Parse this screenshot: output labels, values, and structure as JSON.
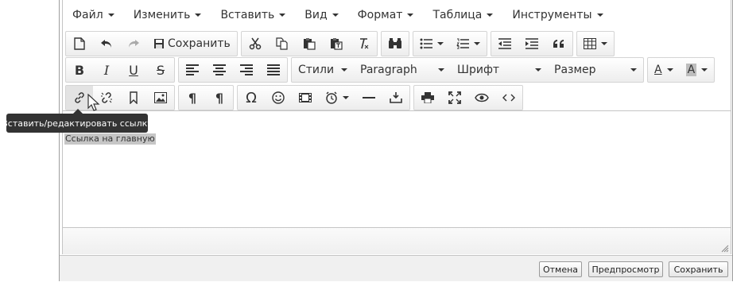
{
  "menubar": {
    "items": [
      {
        "label": "Файл"
      },
      {
        "label": "Изменить"
      },
      {
        "label": "Вставить"
      },
      {
        "label": "Вид"
      },
      {
        "label": "Формат"
      },
      {
        "label": "Таблица"
      },
      {
        "label": "Инструменты"
      }
    ]
  },
  "toolbar1": {
    "new_icon": "new-document-icon",
    "undo_icon": "undo-icon",
    "redo_icon": "redo-icon",
    "save_label": "Сохранить",
    "cut_icon": "cut-icon",
    "copy_icon": "copy-icon",
    "paste_icon": "paste-icon",
    "paste_text_icon": "paste-text-icon",
    "clear_format_icon": "clear-format-icon",
    "find_icon": "find-replace-icon",
    "bullist_icon": "bullet-list-icon",
    "numlist_icon": "numbered-list-icon",
    "outdent_icon": "outdent-icon",
    "indent_icon": "indent-icon",
    "quote_icon": "blockquote-icon",
    "table_icon": "table-icon"
  },
  "toolbar2": {
    "styles_label": "Стили",
    "format_label": "Paragraph",
    "font_label": "Шрифт",
    "size_label": "Размер",
    "text_color_label": "A",
    "bg_color_label": "A"
  },
  "toolbar3": {
    "tooltip": "Вставить/редактировать ссылку"
  },
  "content": {
    "link_text": "Ссылка на главную"
  },
  "footer": {
    "cancel_label": "Отмена",
    "preview_label": "Предпросмотр",
    "save_label": "Сохранить"
  }
}
